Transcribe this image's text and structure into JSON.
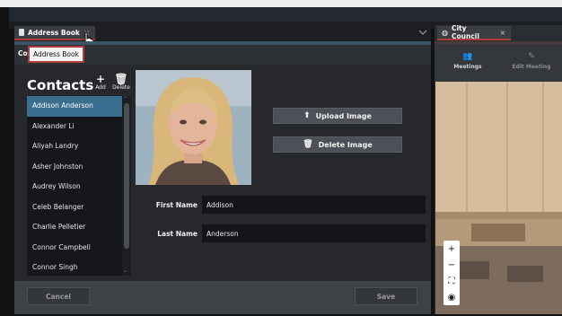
{
  "left_window": {
    "tab_title": "Address Book",
    "tab_close": "×",
    "title_prefix": "Co",
    "title_tooltip": "Address Book"
  },
  "contacts": {
    "heading": "Contacts",
    "add_label": "Add",
    "delete_label": "Delete",
    "items": [
      "Addison Anderson",
      "Alexander Li",
      "Aliyah Landry",
      "Asher Johnston",
      "Audrey Wilson",
      "Celeb Belanger",
      "Charlie Pelletier",
      "Connor Campbell",
      "Connor Singh"
    ],
    "selected_index": 0
  },
  "detail": {
    "upload_label": "Upload Image",
    "delete_image_label": "Delete Image",
    "first_name_label": "First Name",
    "first_name_value": "Addison",
    "last_name_label": "Last Name",
    "last_name_value": "Anderson"
  },
  "footer": {
    "cancel_label": "Cancel",
    "save_label": "Save"
  },
  "right_window": {
    "tab_title": "City Council",
    "tab_close": "×",
    "tools": [
      {
        "label": "Meetings",
        "icon": "people-icon"
      },
      {
        "label": "Edit Meeting",
        "icon": "pencil-icon"
      }
    ],
    "map_controls": [
      "+",
      "−",
      "⛶",
      "◉"
    ]
  },
  "colors": {
    "accent_red": "#b23b3b",
    "selection_blue": "#3b6e8f",
    "panel_bg": "#26282c"
  }
}
